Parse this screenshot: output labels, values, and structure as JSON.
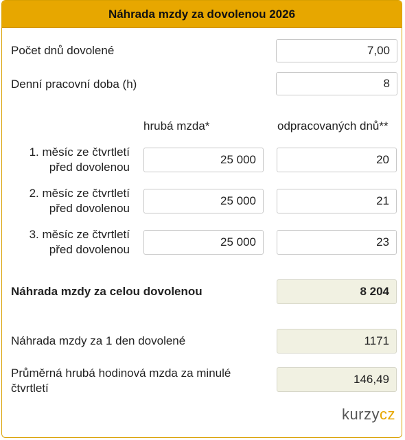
{
  "header": {
    "title": "Náhrada mzdy za dovolenou 2026"
  },
  "fields": {
    "days_label": "Počet dnů dovolené",
    "days_value": "7,00",
    "hours_label": "Denní pracovní doba (h)",
    "hours_value": "8"
  },
  "columns": {
    "gross": "hrubá mzda*",
    "worked": "odpracovaných dnů**"
  },
  "months": [
    {
      "label_line1": "1. měsíc ze čtvrtletí",
      "label_line2": "před dovolenou",
      "gross": "25 000",
      "days": "20"
    },
    {
      "label_line1": "2. měsíc ze čtvrtletí",
      "label_line2": "před dovolenou",
      "gross": "25 000",
      "days": "21"
    },
    {
      "label_line1": "3. měsíc ze čtvrtletí",
      "label_line2": "před dovolenou",
      "gross": "25 000",
      "days": "23"
    }
  ],
  "results": {
    "total_label": "Náhrada mzdy za celou dovolenou",
    "total_value": "8 204",
    "per_day_label": "Náhrada mzdy za 1 den dovolené",
    "per_day_value": "1171",
    "avg_hourly_label_line1": "Průměrná hrubá hodinová mzda za minulé",
    "avg_hourly_label_line2": "čtvrtletí",
    "avg_hourly_value": "146,49"
  },
  "logo": {
    "part1": "kurzy",
    "part2": "cz"
  },
  "colors": {
    "accent": "#e7a700",
    "result_bg": "#f1f1e2"
  }
}
